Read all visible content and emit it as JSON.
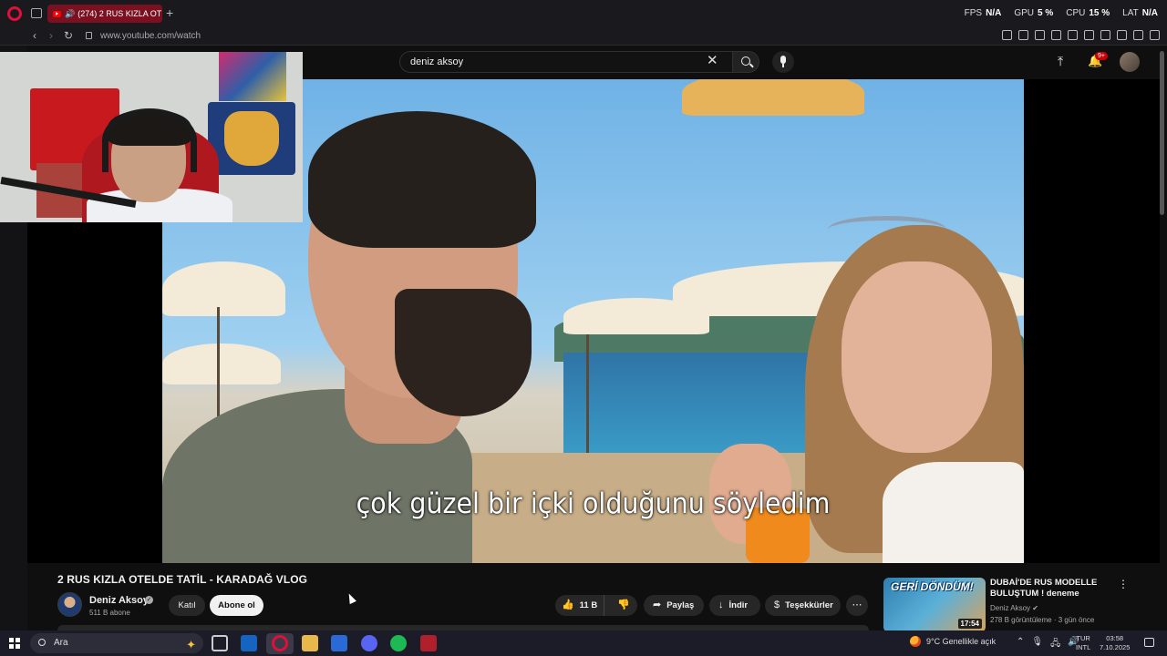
{
  "browser": {
    "tab_title": "(274) 2 RUS KIZLA OT",
    "url": "www.youtube.com/watch",
    "perf": [
      {
        "label": "FPS",
        "value": "N/A"
      },
      {
        "label": "GPU",
        "value": "5 %"
      },
      {
        "label": "CPU",
        "value": "15 %"
      },
      {
        "label": "LAT",
        "value": "N/A"
      }
    ]
  },
  "youtube": {
    "search_query": "deniz aksoy",
    "notification_count": "9+",
    "subtitle": "çok güzel bir içki olduğunu söyledim",
    "video_title": "2 RUS KIZLA OTELDE TATİL - KARADAĞ VLOG",
    "channel": {
      "name": "Deniz Aksoy",
      "subscribers": "511 B abone",
      "join_label": "Katıl",
      "subscribe_label": "Abone ol"
    },
    "actions": {
      "likes": "11 B",
      "share_label": "Paylaş",
      "download_label": "İndir",
      "thanks_label": "Teşekkürler"
    },
    "recommendation": {
      "thumb_text": "GERİ DÖNDÜM!",
      "duration": "17:54",
      "title": "DUBAİ'DE RUS MODELLE BULUŞTUM ! deneme",
      "channel": "Deniz Aksoy",
      "meta": "278 B görüntüleme · 3 gün önce"
    }
  },
  "taskbar": {
    "search_placeholder": "Ara",
    "weather": "9°C  Genellikle açık",
    "lang_line1": "TUR",
    "lang_line2": "INTL",
    "time": "03:58",
    "date": "7.10.2025"
  },
  "colors": {
    "accent_red": "#e0103a",
    "youtube_red": "#ff0000",
    "background": "#0f0f0f"
  }
}
